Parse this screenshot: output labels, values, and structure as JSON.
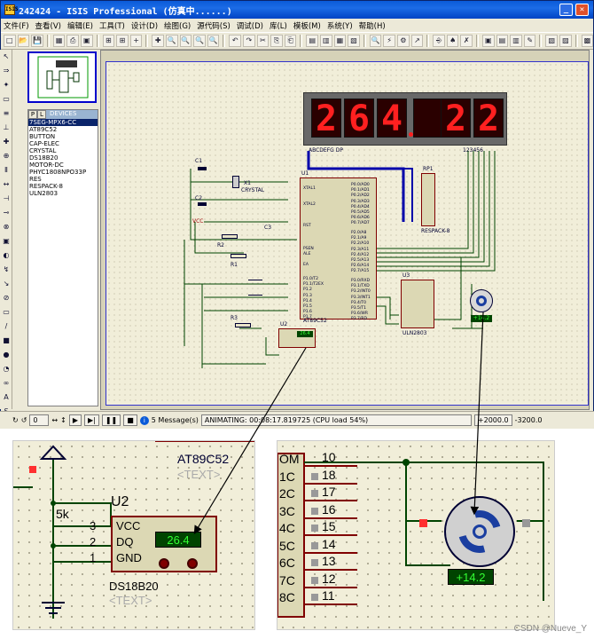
{
  "window": {
    "title": "242424 - ISIS Professional (仿真中......)",
    "icon_text": "ISIS"
  },
  "menu": [
    "文件(F)",
    "查看(V)",
    "编辑(E)",
    "工具(T)",
    "设计(D)",
    "绘图(G)",
    "源代码(S)",
    "调试(D)",
    "库(L)",
    "模板(M)",
    "系统(Y)",
    "帮助(H)"
  ],
  "toolbar_icons": [
    "□",
    "📂",
    "💾",
    "",
    "▦",
    "⎙",
    "▣",
    "",
    "⊞",
    "⊞",
    "+",
    "",
    "✚",
    "🔍",
    "🔍",
    "🔍",
    "🔍",
    "",
    "↶",
    "↷",
    "✂",
    "⎘",
    "⎗",
    "",
    "▤",
    "▥",
    "▦",
    "▧",
    "",
    "🔍",
    "⚡",
    "⚙",
    "↗",
    "",
    "⎆",
    "♠",
    "✗",
    "",
    "▣",
    "▤",
    "▥",
    "✎",
    "",
    "▧",
    "▨",
    "",
    "▩"
  ],
  "left_tools": [
    "↖",
    "⇒",
    "✦",
    "▭",
    "≡",
    "⊥",
    "✚",
    "⊕",
    "Ⅱ",
    "↔",
    "⊣",
    "⊸",
    "⊗",
    "▣",
    "◐",
    "↯",
    "↘",
    "⊘",
    "▭",
    "/",
    "■",
    "●",
    "◔",
    "∞",
    "A",
    "S",
    "✢"
  ],
  "devices": {
    "tab": "P",
    "tab2": "L",
    "header": "DEVICES",
    "items": [
      "7SEG-MPX6-CC",
      "AT89C52",
      "BUTTON",
      "CAP-ELEC",
      "CRYSTAL",
      "DS18B20",
      "MOTOR-DC",
      "PHYC1808NPO33P",
      "RES",
      "RESPACK-8",
      "ULN2803"
    ],
    "selected": 0
  },
  "display": {
    "digits": [
      "2",
      "6",
      "4",
      "",
      "2",
      "2"
    ],
    "dot_after": 2,
    "label_left": "ABCDEFG DP",
    "label_right": "123456"
  },
  "schematic": {
    "u1": "U1",
    "u1_part": "AT89C52",
    "c1": "C1",
    "c2": "C2",
    "c3": "C3",
    "x1": "X1",
    "x1_part": "CRYSTAL",
    "r1": "R1",
    "r2": "R2",
    "r3": "R3",
    "rp1": "RP1",
    "rp1_part": "RESPACK-8",
    "u2": "U2",
    "u3": "U3",
    "u3_part": "ULN2803",
    "vcc": "VCC",
    "u2_readout": "26.4",
    "motor_readout": "+14.2",
    "p0_pins": [
      "P0.0/AD0",
      "P0.1/AD1",
      "P0.2/AD2",
      "P0.3/AD3",
      "P0.4/AD4",
      "P0.5/AD5",
      "P0.6/AD6",
      "P0.7/AD7"
    ],
    "p2_pins": [
      "P2.0/A8",
      "P2.1/A9",
      "P2.2/A10",
      "P2.3/A11",
      "P2.4/A12",
      "P2.5/A13",
      "P2.6/A14",
      "P2.7/A15"
    ],
    "p1_pins": [
      "P1.0/T2",
      "P1.1/T2EX",
      "P1.2",
      "P1.3",
      "P1.4",
      "P1.5",
      "P1.6",
      "P1.7"
    ],
    "p3_pins": [
      "P3.0/RXD",
      "P3.1/TXD",
      "P3.2/INT0",
      "P3.3/INT1",
      "P3.4/T0",
      "P3.5/T1",
      "P3.6/WR",
      "P3.7/RD"
    ],
    "left_pins": [
      "XTAL1",
      "XTAL2",
      "RST",
      "PSEN",
      "ALE",
      "EA"
    ]
  },
  "status": {
    "messages": "5 Message(s)",
    "animating": "ANIMATING: 00:08:17.819725 (CPU load 54%)",
    "coord_x": "+2000.0",
    "coord_y": "-3200.0",
    "frame": "0"
  },
  "zoom_left": {
    "part_label": "AT89C52",
    "text_tag": "<TEXT>",
    "ref": "U2",
    "part": "DS18B20",
    "text_tag2": "<TEXT>",
    "resistor": "5k",
    "pins": [
      {
        "num": "3",
        "name": "VCC"
      },
      {
        "num": "2",
        "name": "DQ"
      },
      {
        "num": "1",
        "name": "GND"
      }
    ],
    "readout": "26.4"
  },
  "zoom_right": {
    "pins": [
      {
        "num": "10",
        "name": "OM"
      },
      {
        "num": "18",
        "name": "1C"
      },
      {
        "num": "17",
        "name": "2C"
      },
      {
        "num": "16",
        "name": "3C"
      },
      {
        "num": "15",
        "name": "4C"
      },
      {
        "num": "14",
        "name": "5C"
      },
      {
        "num": "13",
        "name": "6C"
      },
      {
        "num": "12",
        "name": "7C"
      },
      {
        "num": "11",
        "name": "8C"
      }
    ],
    "readout": "+14.2"
  },
  "watermark": "CSDN @Nueve_Y",
  "colors": {
    "titlebar": "#0a5ad8",
    "seg_on": "#ff2020",
    "readout_bg": "#004400",
    "readout_fg": "#33ff33",
    "wire": "#004400",
    "bus": "#0000aa"
  }
}
